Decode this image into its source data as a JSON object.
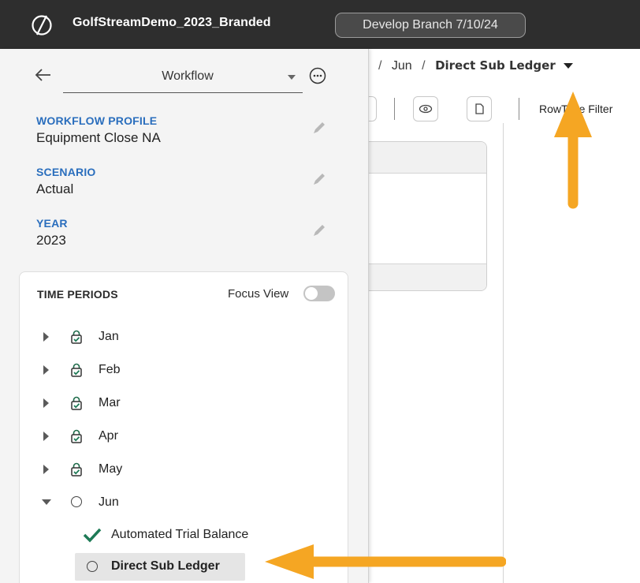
{
  "app": {
    "title": "GolfStreamDemo_2023_Branded",
    "branch": "Develop Branch 7/10/24"
  },
  "workflow_panel": {
    "selector_label": "Workflow",
    "fields": [
      {
        "label": "WORKFLOW PROFILE",
        "value": "Equipment Close NA"
      },
      {
        "label": "SCENARIO",
        "value": "Actual"
      },
      {
        "label": "YEAR",
        "value": "2023"
      }
    ],
    "time_periods": {
      "title": "TIME PERIODS",
      "focus_view_label": "Focus View",
      "focus_view_on": false,
      "periods": [
        {
          "label": "Jan",
          "expanded": false,
          "status": "locked-complete"
        },
        {
          "label": "Feb",
          "expanded": false,
          "status": "locked-complete"
        },
        {
          "label": "Mar",
          "expanded": false,
          "status": "locked-complete"
        },
        {
          "label": "Apr",
          "expanded": false,
          "status": "locked-complete"
        },
        {
          "label": "May",
          "expanded": false,
          "status": "locked-complete"
        },
        {
          "label": "Jun",
          "expanded": true,
          "status": "open"
        }
      ],
      "steps": [
        {
          "label": "Automated Trial Balance",
          "status": "complete"
        },
        {
          "label": "Direct Sub Ledger",
          "status": "open",
          "selected": true
        }
      ]
    }
  },
  "main": {
    "breadcrumb": {
      "separator": "/",
      "period": "Jun",
      "current": "Direct Sub Ledger"
    },
    "toolbar": {
      "filter_label": "RowType Filter"
    }
  },
  "colors": {
    "topbar": "#2e2e2e",
    "field_label": "#2a6ebd",
    "check": "#1e7a56",
    "arrow": "#f5a623"
  }
}
